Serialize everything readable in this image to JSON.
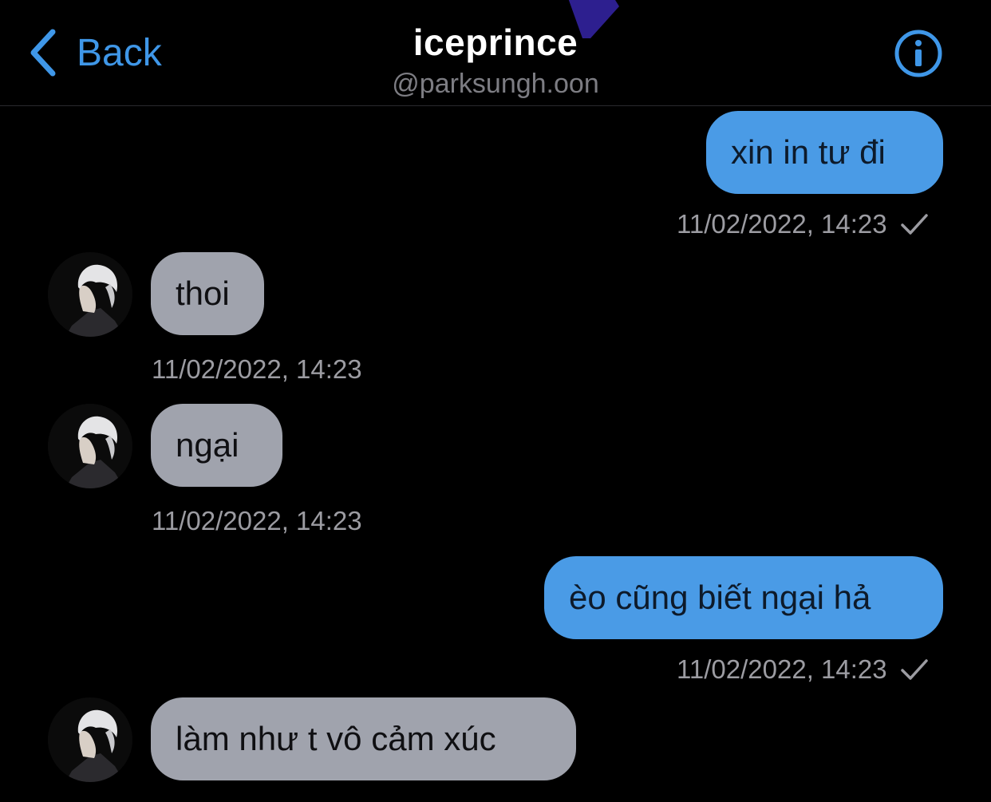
{
  "header": {
    "back_label": "Back",
    "title": "iceprince",
    "handle": "@parksungh.oon",
    "accent_color": "#3f97e8"
  },
  "icons": {
    "back": "chevron-left-icon",
    "info": "info-circle-icon",
    "read_receipt": "checkmark-icon",
    "avatar": "profile-photo"
  },
  "colors": {
    "outgoing_bubble": "#4a9be6",
    "incoming_bubble": "#a0a3ad",
    "background": "#000000",
    "timestamp": "#9c9ca2"
  },
  "messages": [
    {
      "direction": "outgoing",
      "text": "xin in tư đi",
      "timestamp": "11/02/2022, 14:23",
      "read": true
    },
    {
      "direction": "incoming",
      "text": "thoi",
      "timestamp": "11/02/2022, 14:23"
    },
    {
      "direction": "incoming",
      "text": "ngại",
      "timestamp": "11/02/2022, 14:23"
    },
    {
      "direction": "outgoing",
      "text": "èo cũng biết ngại hả",
      "timestamp": "11/02/2022, 14:23",
      "read": true
    },
    {
      "direction": "incoming",
      "text": "làm như t vô cảm xúc"
    }
  ]
}
